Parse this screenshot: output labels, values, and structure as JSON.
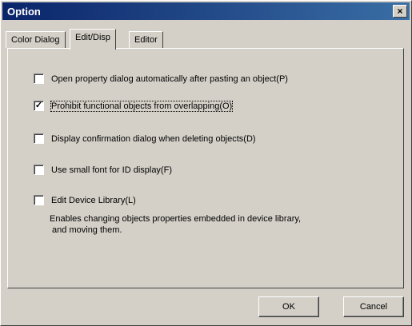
{
  "window": {
    "title": "Option",
    "close_label": "×"
  },
  "tabs": [
    {
      "label": "Color Dialog",
      "active": false
    },
    {
      "label": "Edit/Disp",
      "active": true
    },
    {
      "label": "Editor",
      "active": false
    }
  ],
  "options": [
    {
      "label": "Open property dialog automatically after pasting an object(P)",
      "checked": false
    },
    {
      "label": "Prohibit functional objects from overlapping(O)",
      "checked": true
    },
    {
      "label": "Display confirmation dialog when deleting objects(D)",
      "checked": false
    },
    {
      "label": "Use small font for ID display(F)",
      "checked": false
    },
    {
      "label": "Edit Device Library(L)",
      "checked": false
    }
  ],
  "description_lines": [
    "Enables changing objects properties embedded in device library,",
    " and moving them."
  ],
  "buttons": {
    "ok": "OK",
    "cancel": "Cancel"
  }
}
